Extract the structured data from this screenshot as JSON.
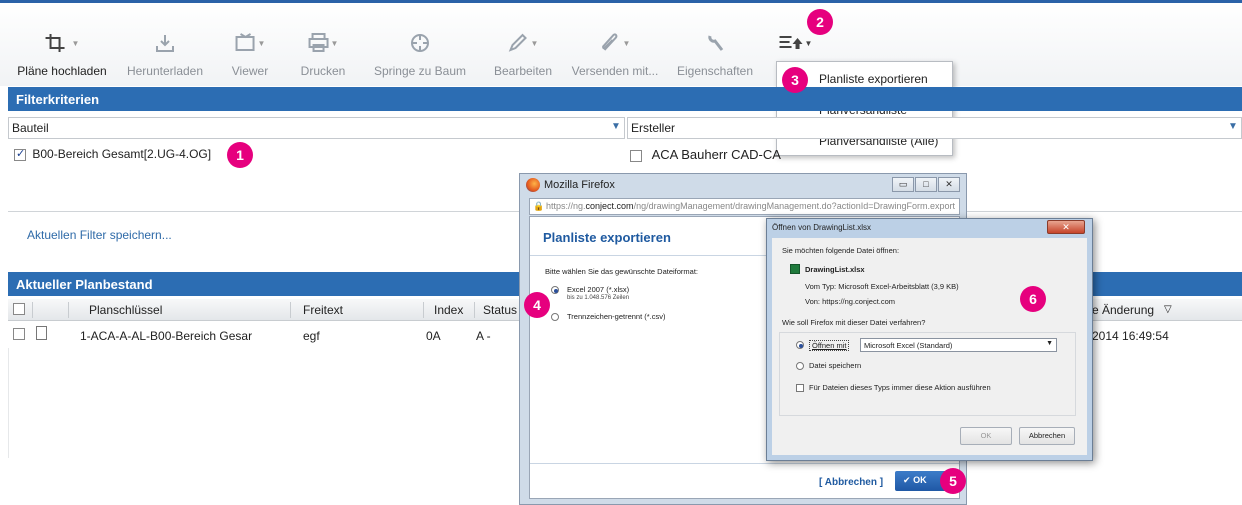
{
  "toolbar": {
    "buttons": [
      {
        "label": "Pläne hochladen",
        "icon": "crop-icon",
        "state": "enabled"
      },
      {
        "label": "Herunterladen",
        "icon": "download-icon",
        "state": "disabled"
      },
      {
        "label": "Viewer",
        "icon": "monitor-icon",
        "state": "disabled"
      },
      {
        "label": "Drucken",
        "icon": "printer-icon",
        "state": "disabled"
      },
      {
        "label": "Springe zu Baum",
        "icon": "target-icon",
        "state": "disabled"
      },
      {
        "label": "Bearbeiten",
        "icon": "pencil-icon",
        "state": "disabled"
      },
      {
        "label": "Versenden mit...",
        "icon": "paperclip-icon",
        "state": "disabled"
      },
      {
        "label": "Eigenschaften",
        "icon": "wrench-icon",
        "state": "disabled"
      }
    ],
    "export_icon": "export-list-icon"
  },
  "export_menu": {
    "items": [
      "Planliste exportieren",
      "Planversandliste",
      "Planversandliste (Alle)"
    ]
  },
  "filter": {
    "title": "Filterkriterien",
    "bauteil_label": "Bauteil",
    "ersteller_label": "Ersteller",
    "bauteil_value": "B00-Bereich Gesamt[2.UG-4.OG]",
    "ersteller_value": "ACA Bauherr CAD-CA",
    "save_link": "Aktuellen Filter speichern..."
  },
  "planbestand": {
    "title": "Aktueller Planbestand",
    "columns": [
      "Planschlüssel",
      "Freitext",
      "Index",
      "Status"
    ],
    "last_change_header": "e Änderung",
    "sort_icon": "▽",
    "row": {
      "planschluessel": "1-ACA-A-AL-B00-Bereich Gesar",
      "freitext": "egf",
      "index": "0A",
      "status": "A -",
      "date": "2014 16:49:54"
    }
  },
  "firefox": {
    "window_title": "Mozilla Firefox",
    "url_prefix": "https://ng.",
    "url_domain": "conject.com",
    "url_rest": "/ng/drawingManagement/drawingManagement.do?actionId=DrawingForm.export",
    "heading": "Planliste exportieren",
    "question": "Bitte wählen Sie das gewünschte Dateiformat:",
    "option1": "Excel 2007 (*.xlsx)",
    "option1_sub": "bis zu 1.048.576 Zeilen",
    "option2": "Trennzeichen-getrennt (*.csv)",
    "cancel": "[ Abbrechen ]",
    "ok": "OK"
  },
  "open_dialog": {
    "title": "Öffnen von DrawingList.xlsx",
    "intro": "Sie möchten folgende Datei öffnen:",
    "filename": "DrawingList.xlsx",
    "type_line": "Vom Typ: Microsoft Excel-Arbeitsblatt (3,9 KB)",
    "from_line": "Von: https://ng.conject.com",
    "question": "Wie soll Firefox mit dieser Datei verfahren?",
    "open_with": "Öffnen mit",
    "open_with_app": "Microsoft Excel (Standard)",
    "save_file": "Datei speichern",
    "always": "Für Dateien dieses Typs immer diese Aktion ausführen",
    "ok": "OK",
    "cancel": "Abbrechen"
  },
  "markers": [
    "1",
    "2",
    "3",
    "4",
    "5",
    "6"
  ],
  "colors": {
    "header_blue": "#2c6db3",
    "marker_pink": "#e6007e",
    "link_blue": "#2e6aa8"
  }
}
